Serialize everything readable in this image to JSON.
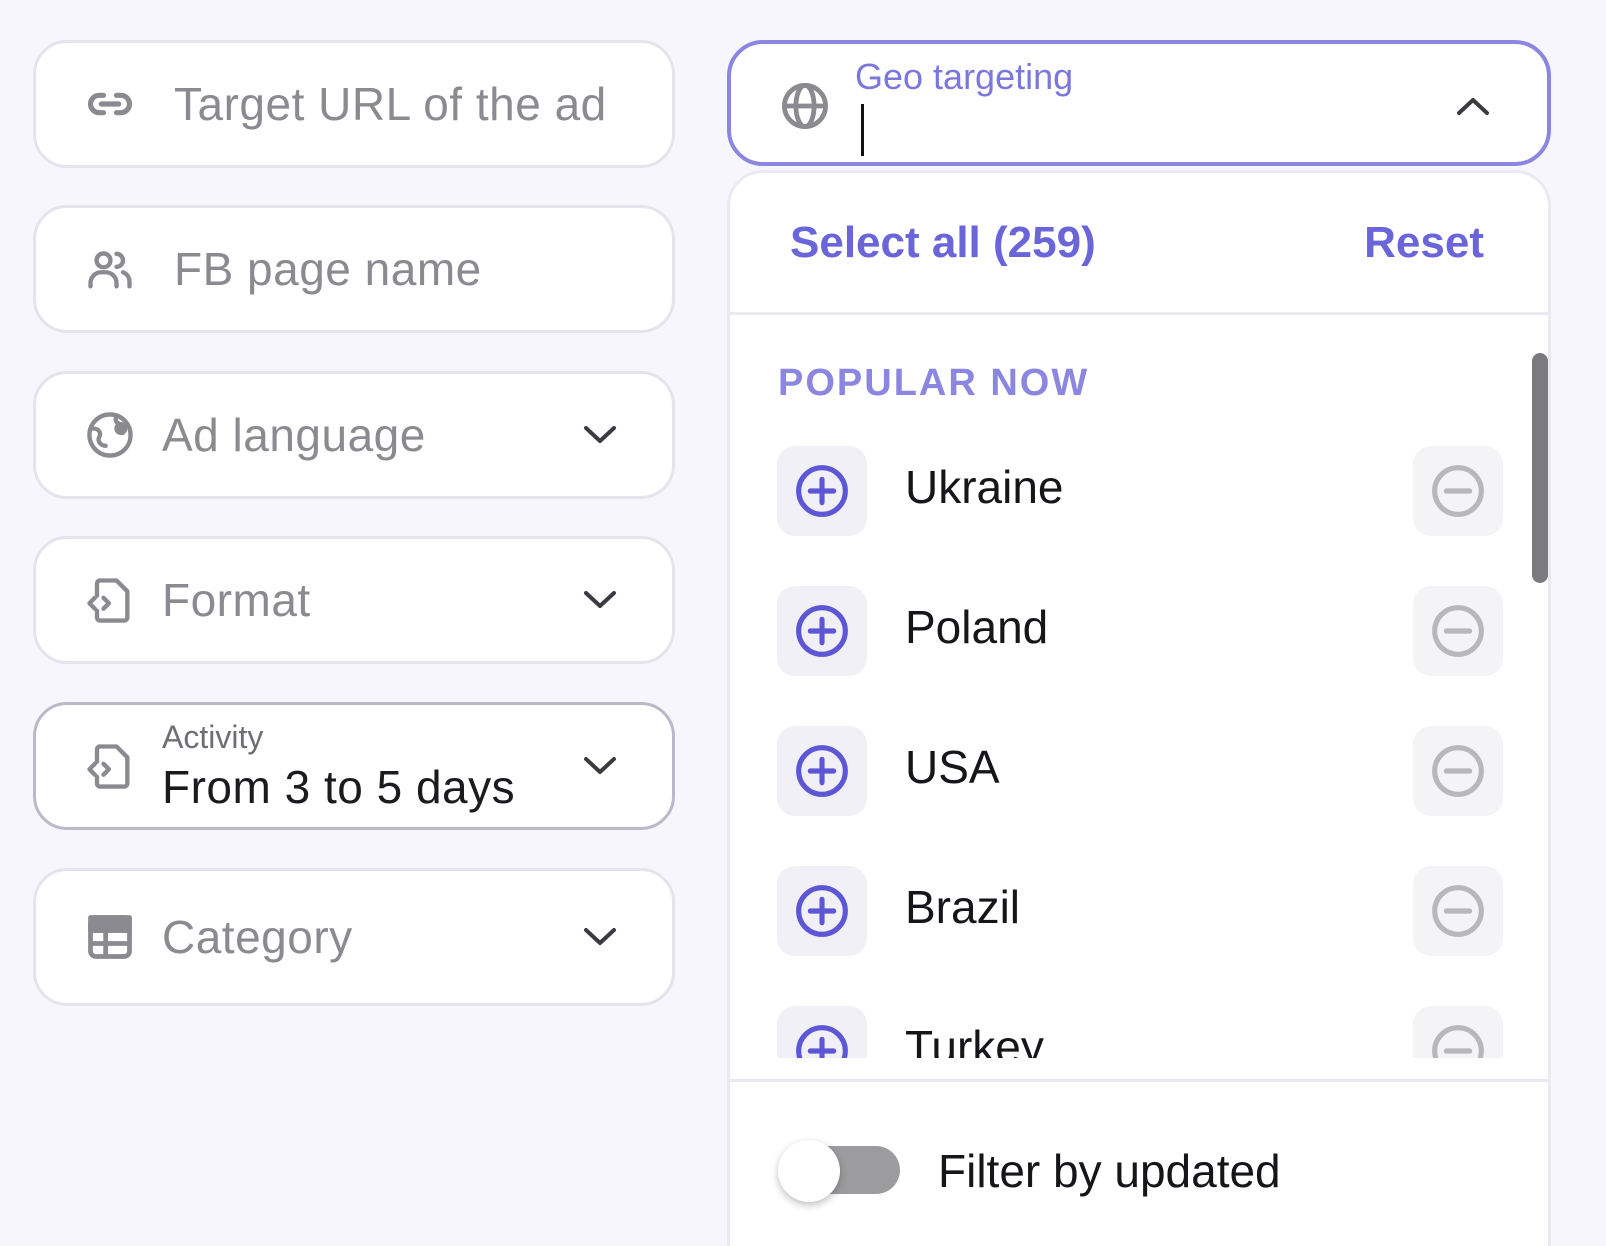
{
  "left_fields": {
    "target_url": {
      "placeholder": "Target URL of the ad",
      "icon": "link-icon"
    },
    "fb_page": {
      "placeholder": "FB page name",
      "icon": "users-icon"
    },
    "ad_language": {
      "placeholder": "Ad language",
      "icon": "globe-language-icon"
    },
    "format": {
      "placeholder": "Format",
      "icon": "file-code-icon"
    },
    "activity": {
      "label": "Activity",
      "value": "From 3 to 5 days",
      "icon": "file-code-icon"
    },
    "category": {
      "placeholder": "Category",
      "icon": "grid-icon"
    }
  },
  "geo": {
    "label": "Geo targeting",
    "value": "",
    "icon": "globe-icon"
  },
  "dropdown": {
    "select_all": "Select all (259)",
    "reset": "Reset",
    "section_title": "POPULAR NOW",
    "countries": [
      "Ukraine",
      "Poland",
      "USA",
      "Brazil",
      "Turkey"
    ],
    "footer_toggle_label": "Filter by updated",
    "footer_toggle_on": false
  },
  "colors": {
    "accent": "#6a65d8",
    "accent_light": "#8b86e0",
    "page_bg": "#f8f6fd"
  }
}
